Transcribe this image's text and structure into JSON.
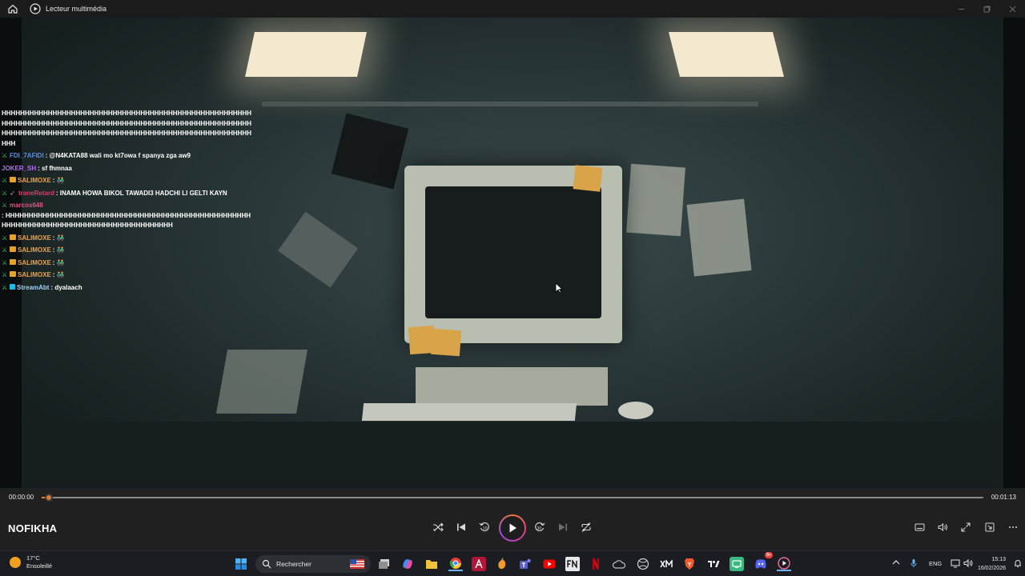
{
  "window": {
    "title": "Lecteur multimédia"
  },
  "chat": {
    "messages": [
      {
        "badges": [],
        "user": "",
        "user_color": "#ffffff",
        "text": "HHHHHHHHHHHHHHHHHHHHHHHHHHHHHHHHHHHHHHHHHHHHHHHHHHHHHHHHHHHHHHHHHHHHHHHHHHHHHHHHHHHHHHHHHHHHHHHHHHHHHHHHHHHHHHHHHHHHHHHHHHHHHHHHHHHHHHHHHHHHHHHHHHHHHHHHHHHHHHHHHHHHH"
      },
      {
        "badges": [
          "sword"
        ],
        "user": "FDI_7AFIDI",
        "user_color": "#4f8ff0",
        "text": ": @N4KATA88 wali mo kt7owa f spanya zga aw9"
      },
      {
        "badges": [],
        "user": "JOKER_SH",
        "user_color": "#b36df2",
        "text": ": sf fhmnaa"
      },
      {
        "badges": [
          "sword",
          "gift"
        ],
        "user": "SALIMOXE",
        "user_color": "#e8a34a",
        "text": ": 👬"
      },
      {
        "badges": [
          "sword",
          "gray"
        ],
        "user": "traneRetard",
        "user_color": "#d83f6a",
        "text": ": INAMA HOWA BIKOL TAWADI3 HADCHI LI GELTI KAYN"
      },
      {
        "badges": [
          "sword"
        ],
        "user": "marcos648",
        "user_color": "#e05585",
        "text": ": HHHHHHHHHHHHHHHHHHHHHHHHHHHHHHHHHHHHHHHHHHHHHHHHHHHHHHHHHHHHHHHHHHHHHHHHHHHHHHHHHHHHHHHHHH"
      },
      {
        "badges": [
          "sword",
          "gift"
        ],
        "user": "SALIMOXE",
        "user_color": "#e8a34a",
        "text": ": 👬"
      },
      {
        "badges": [
          "sword",
          "gift"
        ],
        "user": "SALIMOXE",
        "user_color": "#e8a34a",
        "text": ": 👬"
      },
      {
        "badges": [
          "sword",
          "gift"
        ],
        "user": "SALIMOXE",
        "user_color": "#e8a34a",
        "text": ": 👬"
      },
      {
        "badges": [
          "sword",
          "gift"
        ],
        "user": "SALIMOXE",
        "user_color": "#e8a34a",
        "text": ": 👬"
      },
      {
        "badges": [
          "sword",
          "blue"
        ],
        "user": "StreamAbt",
        "user_color": "#9fd4f5",
        "text": ": dyalaach"
      }
    ]
  },
  "player": {
    "current_time": "00:00:00",
    "total_time": "00:01:13",
    "progress_fraction": 0.008,
    "media_title": "NOFIKHA",
    "accent": "#e07a3b",
    "controls": [
      "shuffle-icon",
      "previous-icon",
      "rewind-10-icon",
      "play-icon",
      "forward-30-icon",
      "next-icon",
      "repeat-off-icon"
    ],
    "right_controls": [
      "subtitles-icon",
      "volume-icon",
      "fullscreen-icon",
      "miniplayer-icon",
      "more-icon"
    ]
  },
  "taskbar": {
    "weather_temp": "17°C",
    "weather_desc": "Ensoleillé",
    "search_placeholder": "Rechercher",
    "lang": "ENG",
    "time": "15:13",
    "date": "16/02/2026",
    "discord_badge": "9+"
  }
}
